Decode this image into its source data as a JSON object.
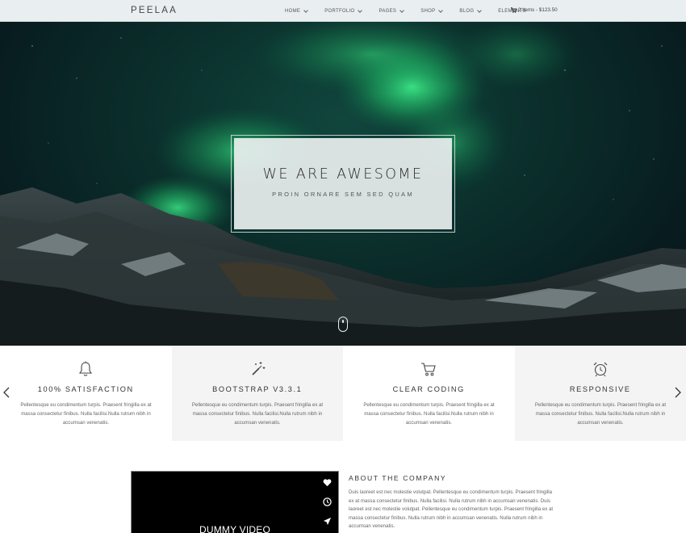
{
  "header": {
    "logo": "PEELAA",
    "nav": [
      {
        "label": "HOME",
        "dropdown": true
      },
      {
        "label": "PORTFOLIO",
        "dropdown": true
      },
      {
        "label": "PAGES",
        "dropdown": true
      },
      {
        "label": "SHOP",
        "dropdown": true
      },
      {
        "label": "BLOG",
        "dropdown": true
      },
      {
        "label": "ELEMENTS",
        "dropdown": false
      }
    ],
    "cart": "2 items - $123.50"
  },
  "hero": {
    "title": "WE ARE AWESOME",
    "subtitle": "PROIN ORNARE SEM SED QUAM"
  },
  "features": [
    {
      "icon": "bell-icon",
      "title": "100% SATISFACTION",
      "text": "Pellentesque eu condimentum turpis. Praesent fringilla ex at massa consectetur finibus. Nulla facilisi.Nulla rutrum nibh in accumsan venenatis."
    },
    {
      "icon": "magic-wand-icon",
      "title": "BOOTSTRAP V3.3.1",
      "text": "Pellentesque eu condimentum turpis. Praesent fringilla ex at massa consectetur finibus. Nulla facilisi.Nulla rutrum nibh in accumsan venenatis."
    },
    {
      "icon": "cart-icon",
      "title": "CLEAR CODING",
      "text": "Pellentesque eu condimentum turpis. Praesent fringilla ex at massa consectetur finibus. Nulla facilisi.Nulla rutrum nibh in accumsan venenatis."
    },
    {
      "icon": "alarm-clock-icon",
      "title": "RESPONSIVE",
      "text": "Pellentesque eu condimentum turpis. Praesent fringilla ex at massa consectetur finibus. Nulla facilisi.Nulla rutrum nibh in accumsan venenatis."
    }
  ],
  "about": {
    "video_label": "DUMMY VIDEO",
    "title": "ABOUT THE COMPANY",
    "text": "Duis laoreet est nec molestie volutpat. Pellentesque eu condimentum turpis. Praesent fringilla ex at massa consectetur finibus. Nulla facilisi. Nulla rutrum nibh in accumsan venenatis. Duis laoreet est nec molestie volutpat. Pellentesque eu condimentum turpis. Praesent fringilla ex at massa consectetur finibus. Nulla rutrum nibh in accumsan venenatis. Nulla rutrum nibh in accumsan venenatis."
  },
  "colors": {
    "header_bg": "#e9eef0",
    "aurora": "#2fd37a",
    "sky": "#0b2f2c",
    "feature_alt_bg": "#f4f4f4"
  }
}
